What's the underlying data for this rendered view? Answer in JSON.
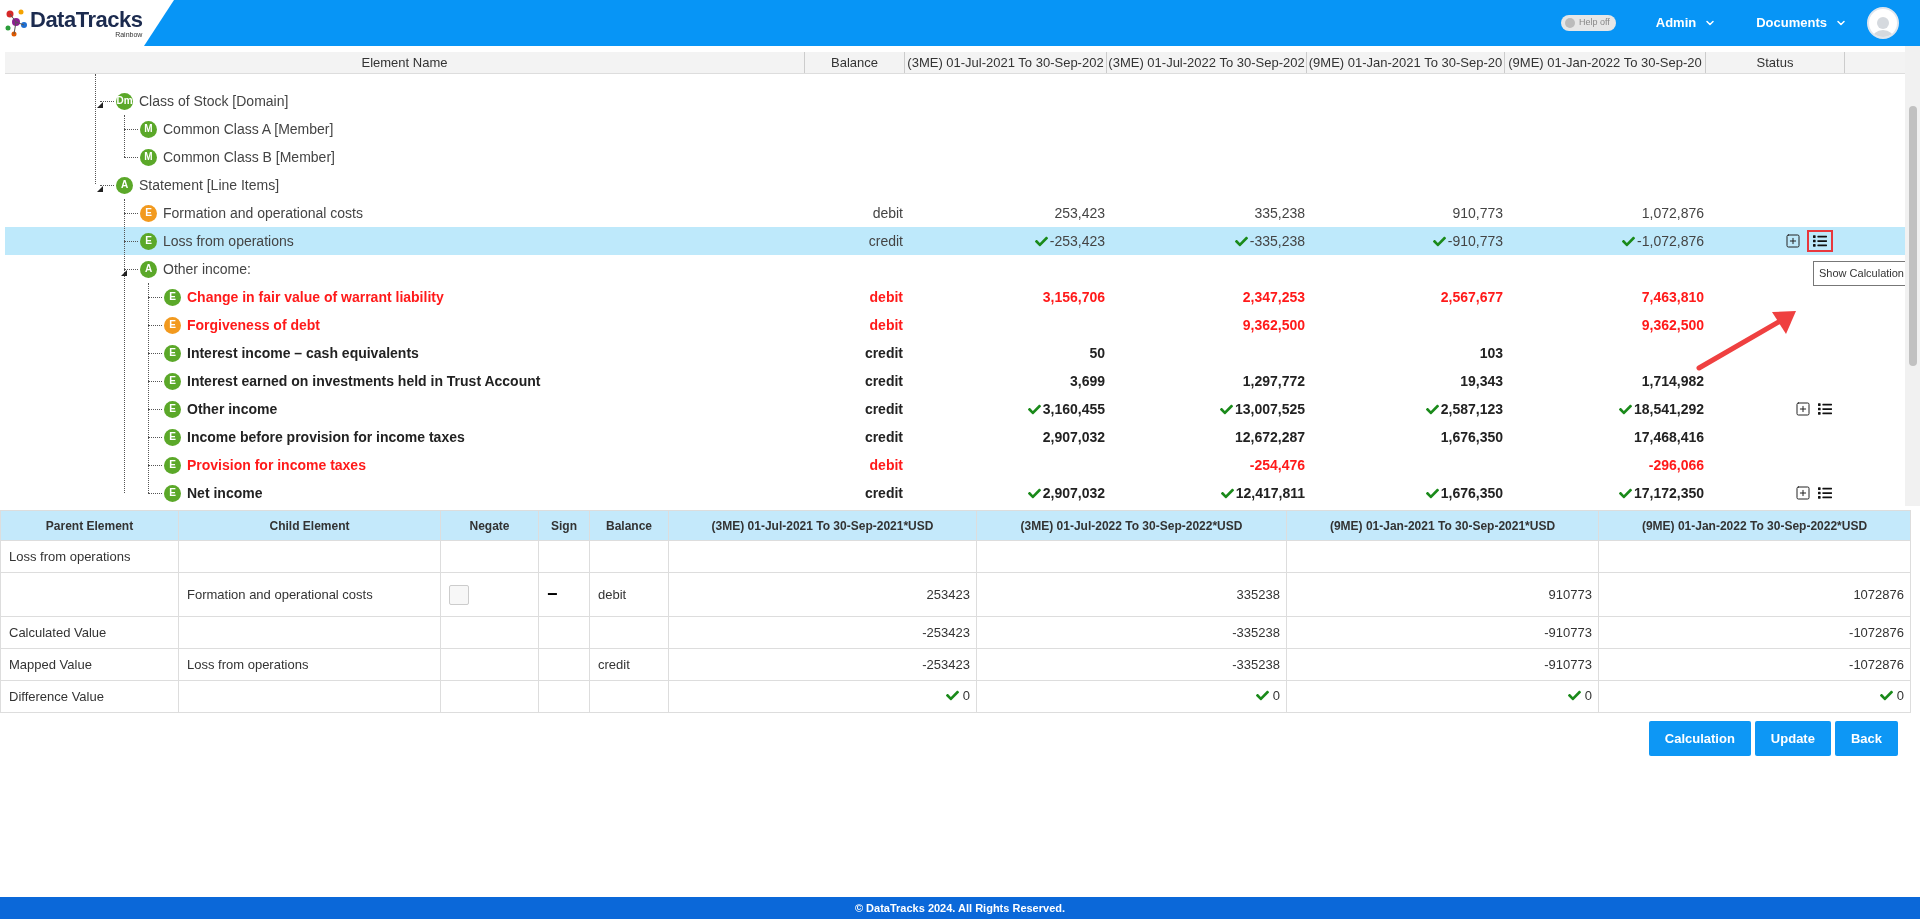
{
  "header": {
    "logo": {
      "name": "DataTracks",
      "tagline": "Rainbow"
    },
    "help_toggle": {
      "label": "Help off",
      "on": false
    },
    "menus": [
      "Admin",
      "Documents"
    ]
  },
  "grid": {
    "columns": [
      "Element Name",
      "Balance",
      "(3ME) 01-Jul-2021 To 30-Sep-202",
      "(3ME) 01-Jul-2022 To 30-Sep-202",
      "(9ME) 01-Jan-2021 To 30-Sep-20",
      "(9ME) 01-Jan-2022 To 30-Sep-20",
      "Status"
    ],
    "tree": [
      {
        "badge": "Dm",
        "color": "#5ba829",
        "label": "Class of Stock [Domain]",
        "kind": "plain",
        "selected": false,
        "expanded": true,
        "has_calculation": false,
        "children": [
          {
            "badge": "M",
            "color": "#5ba829",
            "label": "Common Class A [Member]",
            "kind": "plain",
            "selected": false,
            "expanded": false,
            "has_calculation": false
          },
          {
            "badge": "M",
            "color": "#5ba829",
            "label": "Common Class B [Member]",
            "kind": "plain",
            "selected": false,
            "expanded": false,
            "has_calculation": false
          }
        ]
      },
      {
        "badge": "A",
        "color": "#5ba829",
        "label": "Statement [Line Items]",
        "kind": "plain",
        "selected": false,
        "expanded": true,
        "has_calculation": false,
        "children": [
          {
            "badge": "E",
            "color": "#f29a1f",
            "label": "Formation and operational costs",
            "kind": "plain",
            "selected": false,
            "expanded": false,
            "has_calculation": false,
            "balance": "debit",
            "value_1": {
              "text": "253,423",
              "checked": false
            },
            "value_2": {
              "text": "335,238",
              "checked": false
            },
            "value_3": {
              "text": "910,773",
              "checked": false
            },
            "value_4": {
              "text": "1,072,876",
              "checked": false
            }
          },
          {
            "badge": "E",
            "color": "#5ba829",
            "label": "Loss from operations",
            "kind": "plain",
            "selected": true,
            "expanded": false,
            "has_calculation": true,
            "callout": "Show Calculation",
            "balance": "credit",
            "value_1": {
              "text": "-253,423",
              "checked": true
            },
            "value_2": {
              "text": "-335,238",
              "checked": true
            },
            "value_3": {
              "text": "-910,773",
              "checked": true
            },
            "value_4": {
              "text": "-1,072,876",
              "checked": true
            }
          },
          {
            "badge": "A",
            "color": "#5ba829",
            "label": "Other income:",
            "kind": "plain",
            "selected": false,
            "expanded": true,
            "has_calculation": false,
            "children": [
              {
                "badge": "E",
                "color": "#5ba829",
                "label": "Change in fair value of warrant liability",
                "kind": "alert",
                "selected": false,
                "expanded": false,
                "has_calculation": false,
                "balance": "debit",
                "value_1": {
                  "text": "3,156,706",
                  "checked": false
                },
                "value_2": {
                  "text": "2,347,253",
                  "checked": false
                },
                "value_3": {
                  "text": "2,567,677",
                  "checked": false
                },
                "value_4": {
                  "text": "7,463,810",
                  "checked": false
                }
              },
              {
                "badge": "E",
                "color": "#f29a1f",
                "label": "Forgiveness of debt",
                "kind": "alert",
                "selected": false,
                "expanded": false,
                "has_calculation": false,
                "balance": "debit",
                "value_2": {
                  "text": "9,362,500",
                  "checked": false
                },
                "value_4": {
                  "text": "9,362,500",
                  "checked": false
                }
              },
              {
                "badge": "E",
                "color": "#5ba829",
                "label": "Interest income – cash equivalents",
                "kind": "bold",
                "selected": false,
                "expanded": false,
                "has_calculation": false,
                "balance": "credit",
                "value_1": {
                  "text": "50",
                  "checked": false
                },
                "value_3": {
                  "text": "103",
                  "checked": false
                }
              },
              {
                "badge": "E",
                "color": "#5ba829",
                "label": "Interest earned on investments held in Trust Account",
                "kind": "bold",
                "selected": false,
                "expanded": false,
                "has_calculation": false,
                "balance": "credit",
                "value_1": {
                  "text": "3,699",
                  "checked": false
                },
                "value_2": {
                  "text": "1,297,772",
                  "checked": false
                },
                "value_3": {
                  "text": "19,343",
                  "checked": false
                },
                "value_4": {
                  "text": "1,714,982",
                  "checked": false
                }
              },
              {
                "badge": "E",
                "color": "#5ba829",
                "label": "Other income",
                "kind": "bold",
                "selected": false,
                "expanded": false,
                "has_calculation": true,
                "balance": "credit",
                "value_1": {
                  "text": "3,160,455",
                  "checked": true
                },
                "value_2": {
                  "text": "13,007,525",
                  "checked": true
                },
                "value_3": {
                  "text": "2,587,123",
                  "checked": true
                },
                "value_4": {
                  "text": "18,541,292",
                  "checked": true
                }
              },
              {
                "badge": "E",
                "color": "#5ba829",
                "label": "Income before provision for income taxes",
                "kind": "bold",
                "selected": false,
                "expanded": false,
                "has_calculation": false,
                "balance": "credit",
                "value_1": {
                  "text": "2,907,032",
                  "checked": false
                },
                "value_2": {
                  "text": "12,672,287",
                  "checked": false
                },
                "value_3": {
                  "text": "1,676,350",
                  "checked": false
                },
                "value_4": {
                  "text": "17,468,416",
                  "checked": false
                }
              },
              {
                "badge": "E",
                "color": "#5ba829",
                "label": "Provision for income taxes",
                "kind": "alert",
                "selected": false,
                "expanded": false,
                "has_calculation": false,
                "balance": "debit",
                "value_2": {
                  "text": "-254,476",
                  "checked": false
                },
                "value_4": {
                  "text": "-296,066",
                  "checked": false
                }
              },
              {
                "badge": "E",
                "color": "#5ba829",
                "label": "Net income",
                "kind": "bold",
                "selected": false,
                "expanded": false,
                "has_calculation": true,
                "balance": "credit",
                "value_1": {
                  "text": "2,907,032",
                  "checked": true
                },
                "value_2": {
                  "text": "12,417,811",
                  "checked": true
                },
                "value_3": {
                  "text": "1,676,350",
                  "checked": true
                },
                "value_4": {
                  "text": "17,172,350",
                  "checked": true
                }
              }
            ]
          }
        ]
      }
    ]
  },
  "calc_table": {
    "columns": [
      "Parent Element",
      "Child Element",
      "Negate",
      "Sign",
      "Balance",
      "(3ME) 01-Jul-2021 To 30-Sep-2021*USD",
      "(3ME) 01-Jul-2022 To 30-Sep-2022*USD",
      "(9ME) 01-Jan-2021 To 30-Sep-2021*USD",
      "(9ME) 01-Jan-2022 To 30-Sep-2022*USD"
    ],
    "rows": [
      {
        "kind": "parent",
        "parent": "Loss from operations"
      },
      {
        "kind": "child",
        "child": "Formation and operational costs",
        "negate": {
          "checked": false
        },
        "sign": "−",
        "balance": "debit",
        "values": [
          {
            "text": "253423",
            "checked": false
          },
          {
            "text": "335238",
            "checked": false
          },
          {
            "text": "910773",
            "checked": false
          },
          {
            "text": "1072876",
            "checked": false
          }
        ]
      },
      {
        "kind": "summary",
        "parent": "Calculated Value",
        "values": [
          {
            "text": "-253423",
            "checked": false
          },
          {
            "text": "-335238",
            "checked": false
          },
          {
            "text": "-910773",
            "checked": false
          },
          {
            "text": "-1072876",
            "checked": false
          }
        ]
      },
      {
        "kind": "summary",
        "parent": "Mapped Value",
        "child": "Loss from operations",
        "balance": "credit",
        "values": [
          {
            "text": "-253423",
            "checked": false
          },
          {
            "text": "-335238",
            "checked": false
          },
          {
            "text": "-910773",
            "checked": false
          },
          {
            "text": "-1072876",
            "checked": false
          }
        ]
      },
      {
        "kind": "summary",
        "parent": "Difference Value",
        "values": [
          {
            "text": "0",
            "checked": true
          },
          {
            "text": "0",
            "checked": true
          },
          {
            "text": "0",
            "checked": true
          },
          {
            "text": "0",
            "checked": true
          }
        ]
      }
    ]
  },
  "buttons": [
    "Calculation",
    "Update",
    "Back"
  ],
  "footer": "© DataTracks 2024. All Rights Reserved."
}
